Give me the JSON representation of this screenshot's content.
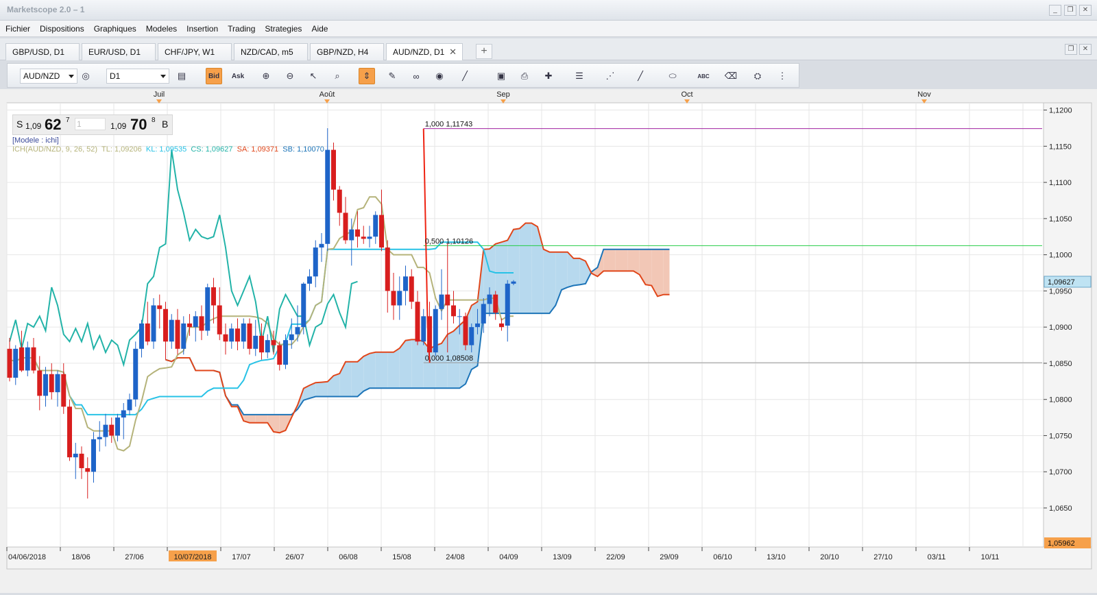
{
  "window": {
    "title": "Marketscope 2.0 – 1"
  },
  "menu": [
    "Fichier",
    "Dispositions",
    "Graphiques",
    "Modeles",
    "Insertion",
    "Trading",
    "Strategies",
    "Aide"
  ],
  "tabs": [
    "GBP/USD, D1",
    "EUR/USD, D1",
    "CHF/JPY, W1",
    "NZD/CAD, m5",
    "GBP/NZD, H4",
    "AUD/NZD, D1"
  ],
  "toolbar": {
    "symbol": "AUD/NZD",
    "timeframe": "D1",
    "bid_label": "Bid",
    "ask_label": "Ask"
  },
  "price": {
    "s_label": "S",
    "sell_prefix": "1,09",
    "sell_big": "62",
    "sell_sup": "7",
    "qty": "1",
    "buy_prefix": "1,09",
    "buy_big": "70",
    "buy_sup": "8",
    "b_label": "B"
  },
  "indicator": {
    "model": "[Modele : ichi]",
    "name": "ICH(AUD/NZD, 9, 26, 52)",
    "tl": "TL: 1,09206",
    "kl": "KL: 1,09535",
    "cs": "CS: 1,09627",
    "sa": "SA: 1,09371",
    "sb": "SB: 1,10070"
  },
  "fib": {
    "top": "1,000 1,11743",
    "mid": "0,500 1,10126",
    "bottom": "0,000 1,08508"
  },
  "months": [
    "Juil",
    "Août",
    "Sep",
    "Oct",
    "Nov"
  ],
  "x_dates": [
    "04/06/2018",
    "18/06",
    "27/06",
    "10/07/2018",
    "17/07",
    "26/07",
    "06/08",
    "15/08",
    "24/08",
    "04/09",
    "13/09",
    "22/09",
    "29/09",
    "06/10",
    "13/10",
    "20/10",
    "27/10",
    "03/11",
    "10/11"
  ],
  "y_ticks": [
    "1,1200",
    "1,1150",
    "1,1100",
    "1,1050",
    "1,1000",
    "1,0950",
    "1,0900",
    "1,0850",
    "1,0800",
    "1,0750",
    "1,0700",
    "1,0650"
  ],
  "last_price": "1,09627",
  "min_label": "1,05962",
  "colors": {
    "up": "#1e64c8",
    "down": "#d81e1e",
    "tenkan": "#b5b37a",
    "kijun": "#27c2e6",
    "chikou": "#22b3a8",
    "spanA": "#e0461a",
    "spanB": "#1c74b8",
    "cloudUp": "#b7d9ee",
    "cloudDown": "#f2c7b6"
  },
  "chart_data": {
    "type": "candlestick",
    "ylim": [
      1.0596,
      1.121
    ],
    "candles": [
      [
        1.087,
        1.0885,
        1.0825,
        1.083
      ],
      [
        1.083,
        1.0875,
        1.082,
        1.087
      ],
      [
        1.0872,
        1.0895,
        1.0838,
        1.084
      ],
      [
        1.084,
        1.088,
        1.0832,
        1.0872
      ],
      [
        1.0872,
        1.0885,
        1.0836,
        1.084
      ],
      [
        1.084,
        1.086,
        1.0785,
        1.0805
      ],
      [
        1.0805,
        1.0845,
        1.079,
        1.0835
      ],
      [
        1.0835,
        1.085,
        1.08,
        1.081
      ],
      [
        1.081,
        1.084,
        1.079,
        1.0835
      ],
      [
        1.0835,
        1.085,
        1.078,
        1.079
      ],
      [
        1.079,
        1.08,
        1.0715,
        1.072
      ],
      [
        1.072,
        1.074,
        1.069,
        1.0725
      ],
      [
        1.0725,
        1.0735,
        1.069,
        1.0705
      ],
      [
        1.0705,
        1.072,
        1.0663,
        1.07
      ],
      [
        1.07,
        1.0755,
        1.0685,
        1.0745
      ],
      [
        1.0745,
        1.077,
        1.0728,
        1.0748
      ],
      [
        1.0748,
        1.078,
        1.0735,
        1.0765
      ],
      [
        1.0765,
        1.0775,
        1.074,
        1.075
      ],
      [
        1.075,
        1.078,
        1.0742,
        1.0775
      ],
      [
        1.0775,
        1.0795,
        1.0745,
        1.0785
      ],
      [
        1.0785,
        1.0808,
        1.0778,
        1.08
      ],
      [
        1.08,
        1.088,
        1.079,
        1.087
      ],
      [
        1.087,
        1.091,
        1.0858,
        1.0905
      ],
      [
        1.0905,
        1.0935,
        1.0875,
        1.088
      ],
      [
        1.088,
        1.094,
        1.087,
        1.093
      ],
      [
        1.093,
        1.0945,
        1.0898,
        1.0925
      ],
      [
        1.0925,
        1.0935,
        1.0855,
        1.088
      ],
      [
        1.088,
        1.0918,
        1.087,
        1.091
      ],
      [
        1.091,
        1.0925,
        1.0862,
        1.087
      ],
      [
        1.087,
        1.0915,
        1.0862,
        1.0905
      ],
      [
        1.0905,
        1.0918,
        1.0888,
        1.09
      ],
      [
        1.09,
        1.0922,
        1.088,
        1.0915
      ],
      [
        1.0915,
        1.093,
        1.0882,
        1.0895
      ],
      [
        1.0895,
        1.096,
        1.0888,
        1.0955
      ],
      [
        1.0955,
        1.0968,
        1.0905,
        1.093
      ],
      [
        1.093,
        1.0955,
        1.0882,
        1.089
      ],
      [
        1.089,
        1.0905,
        1.0862,
        1.088
      ],
      [
        1.088,
        1.0905,
        1.087,
        1.0898
      ],
      [
        1.0898,
        1.0912,
        1.0868,
        1.088
      ],
      [
        1.088,
        1.0912,
        1.087,
        1.0905
      ],
      [
        1.0905,
        1.0912,
        1.0862,
        1.087
      ],
      [
        1.087,
        1.091,
        1.086,
        1.0888
      ],
      [
        1.0888,
        1.0905,
        1.0855,
        1.0865
      ],
      [
        1.0865,
        1.089,
        1.0857,
        1.0882
      ],
      [
        1.0882,
        1.0895,
        1.0862,
        1.0875
      ],
      [
        1.0875,
        1.088,
        1.084,
        1.0848
      ],
      [
        1.0848,
        1.089,
        1.0842,
        1.0882
      ],
      [
        1.0882,
        1.0912,
        1.087,
        1.089
      ],
      [
        1.089,
        1.093,
        1.088,
        1.09
      ],
      [
        1.09,
        1.0962,
        1.089,
        1.096
      ],
      [
        1.096,
        1.098,
        1.095,
        1.097
      ],
      [
        1.097,
        1.102,
        1.0955,
        1.101
      ],
      [
        1.101,
        1.103,
        1.099,
        1.1015
      ],
      [
        1.1015,
        1.1175,
        1.1005,
        1.1145
      ],
      [
        1.1145,
        1.1155,
        1.1075,
        1.109
      ],
      [
        1.109,
        1.1095,
        1.104,
        1.1058
      ],
      [
        1.1058,
        1.108,
        1.1015,
        1.102
      ],
      [
        1.102,
        1.105,
        1.0985,
        1.1035
      ],
      [
        1.1035,
        1.106,
        1.101,
        1.1025
      ],
      [
        1.1025,
        1.104,
        1.1015,
        1.1022
      ],
      [
        1.1022,
        1.104,
        1.101,
        1.1025
      ],
      [
        1.1025,
        1.106,
        1.1015,
        1.1055
      ],
      [
        1.1055,
        1.109,
        1.1005,
        1.101
      ],
      [
        1.101,
        1.102,
        1.092,
        1.095
      ],
      [
        1.095,
        1.0975,
        1.091,
        1.093
      ],
      [
        1.093,
        1.097,
        1.091,
        1.095
      ],
      [
        1.095,
        1.0985,
        1.093,
        1.097
      ],
      [
        1.097,
        1.098,
        1.0925,
        1.0935
      ],
      [
        1.0935,
        1.095,
        1.0875,
        1.088
      ],
      [
        1.088,
        1.0925,
        1.0875,
        1.0915
      ],
      [
        1.0915,
        1.0935,
        1.086,
        1.0865
      ],
      [
        1.0865,
        1.093,
        1.086,
        1.0925
      ],
      [
        1.0925,
        1.098,
        1.091,
        1.0945
      ],
      [
        1.0945,
        1.1015,
        1.0865,
        1.093
      ],
      [
        1.093,
        1.095,
        1.0905,
        1.0915
      ],
      [
        1.0915,
        1.0925,
        1.089,
        1.0915
      ],
      [
        1.0915,
        1.092,
        1.0868,
        1.0875
      ],
      [
        1.0875,
        1.0905,
        1.0865,
        1.09
      ],
      [
        1.09,
        1.0925,
        1.089,
        1.0905
      ],
      [
        1.0905,
        1.094,
        1.0892,
        1.0932
      ],
      [
        1.0932,
        1.0955,
        1.0915,
        1.0945
      ],
      [
        1.0945,
        1.095,
        1.091,
        1.092
      ],
      [
        1.0905,
        1.0912,
        1.0895,
        1.09
      ],
      [
        1.0902,
        1.0965,
        1.088,
        1.096
      ],
      [
        1.096,
        1.0965,
        1.0958,
        1.0963
      ]
    ]
  }
}
